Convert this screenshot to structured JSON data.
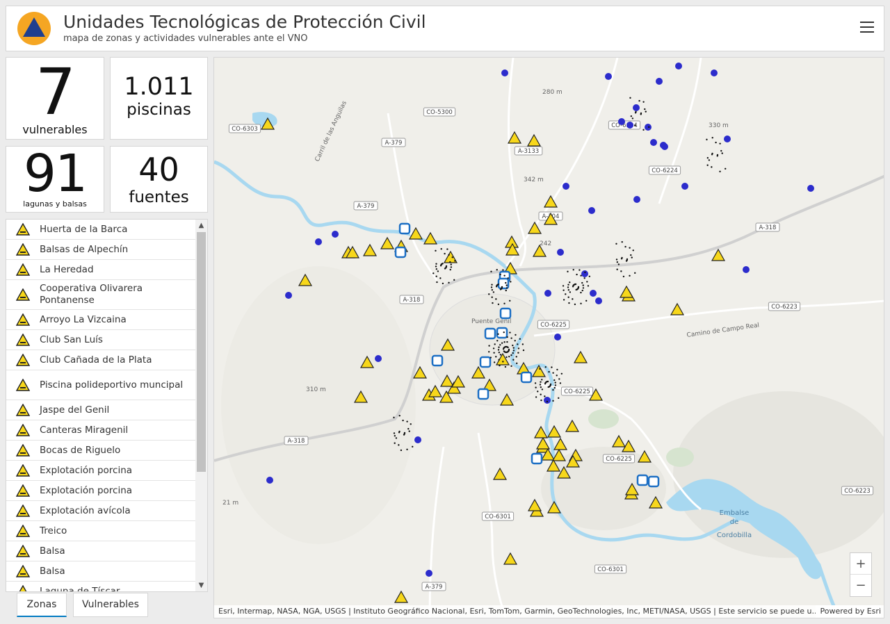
{
  "header": {
    "title": "Unidades Tecnológicas de Protección Civil",
    "subtitle": "mapa de zonas y actividades vulnerables ante el VNO"
  },
  "stats": [
    {
      "value": "7",
      "label": "vulnerables"
    },
    {
      "value": "1.011",
      "label": "piscinas"
    },
    {
      "value": "91",
      "label": "lagunas y balsas"
    },
    {
      "value": "40",
      "label": "fuentes"
    }
  ],
  "list": {
    "items": [
      {
        "label": "Huerta de la Barca"
      },
      {
        "label": "Balsas de Alpechín"
      },
      {
        "label": "La Heredad"
      },
      {
        "label": "Cooperativa Olivarera Pontanense"
      },
      {
        "label": "Arroyo La Vizcaina"
      },
      {
        "label": "Club San Luís"
      },
      {
        "label": "Club Cañada de la Plata"
      },
      {
        "label": "Piscina polideportivo muncipal"
      },
      {
        "label": "Jaspe del Genil"
      },
      {
        "label": "Canteras Miragenil"
      },
      {
        "label": "Bocas de Riguelo"
      },
      {
        "label": "Explotación porcina"
      },
      {
        "label": "Explotación porcina"
      },
      {
        "label": "Explotación avícola"
      },
      {
        "label": "Treico"
      },
      {
        "label": "Balsa"
      },
      {
        "label": "Balsa"
      },
      {
        "label": "Laguna de Tíscar"
      }
    ]
  },
  "tabs": [
    {
      "label": "Zonas",
      "active": true
    },
    {
      "label": "Vulnerables",
      "active": false
    }
  ],
  "map": {
    "road_labels": [
      "CO-5300",
      "CO-6303",
      "A-379",
      "A-3133",
      "CO-6224",
      "A-379",
      "A-304",
      "A-318",
      "A-318",
      "CO-6223",
      "CO-6225",
      "CO-6225",
      "A-318",
      "CO-6225",
      "CO-6301",
      "CO-6301",
      "CO-6223",
      "A-379",
      "CO-6304"
    ],
    "place_labels": [
      "280 m",
      "330 m",
      "342 m",
      "310 m",
      "21 m",
      "242",
      "Carril de las Anguilas",
      "Camino de Campo Real",
      "Puente Genil"
    ],
    "water_label_lines": [
      "Embalse",
      "de",
      "Cordobilla"
    ],
    "attribution": "Esri, Intermap, NASA, NGA, USGS | Instituto Geográfico Nacional, Esri, TomTom, Garmin, GeoTechnologies, Inc, METI/NASA, USGS | Este servicio se puede u...",
    "powered_by": "Powered by Esri",
    "zoom_in": "+",
    "zoom_out": "−"
  },
  "colors": {
    "accent": "#007ac2",
    "warning_fill": "#f7d71b",
    "logo_orange": "#f5a623",
    "logo_blue": "#1f3f8f",
    "info_blue": "#2c2ccc",
    "water": "#a8d8f0"
  },
  "icons": {
    "list_item": "warning-triangle-icon",
    "menu": "hamburger-menu-icon",
    "logo": "civil-protection-logo-icon"
  }
}
